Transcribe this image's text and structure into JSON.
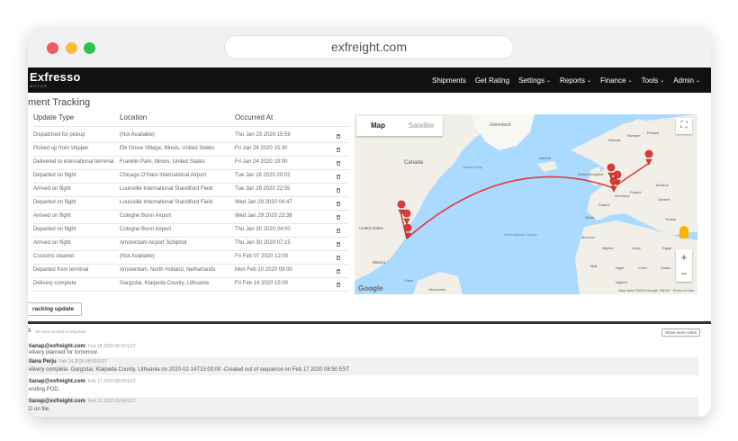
{
  "browser": {
    "url": "exfreight.com"
  },
  "navbar": {
    "brand": "Exfresso",
    "brand_sub": "MOTOR",
    "items": [
      {
        "label": "Shipments",
        "dropdown": false
      },
      {
        "label": "Get Rating",
        "dropdown": false
      },
      {
        "label": "Settings",
        "dropdown": true
      },
      {
        "label": "Reports",
        "dropdown": true
      },
      {
        "label": "Finance",
        "dropdown": true
      },
      {
        "label": "Tools",
        "dropdown": true
      },
      {
        "label": "Admin",
        "dropdown": true
      }
    ]
  },
  "tracking": {
    "title": "ment Tracking",
    "columns": [
      "Update Type",
      "Location",
      "Occurred At"
    ],
    "rows": [
      [
        "Dispatched for pickup",
        "(Not Available)",
        "Thu Jan 23 2020 15:59"
      ],
      [
        "Picked up from shipper",
        "Elk Grove Village, Illinois, United States",
        "Fri Jan 24 2020 15:30"
      ],
      [
        "Delivered to international terminal",
        "Franklin Park, Illinois, United States",
        "Fri Jan 24 2020 19:00"
      ],
      [
        "Departed on flight",
        "Chicago O'Hare International Airport",
        "Tue Jan 28 2020 20:02"
      ],
      [
        "Arrived on flight",
        "Louisville International Standiford Field",
        "Tue Jan 28 2020 22:55"
      ],
      [
        "Departed on flight",
        "Louisville International Standiford Field",
        "Wed Jan 29 2020 04:47"
      ],
      [
        "Arrived on flight",
        "Cologne Bonn Airport",
        "Wed Jan 29 2020 23:38"
      ],
      [
        "Departed on flight",
        "Cologne Bonn Airport",
        "Thu Jan 30 2020 04:00"
      ],
      [
        "Arrived on flight",
        "Amsterdam Airport Schiphol",
        "Thu Jan 30 2020 07:15"
      ],
      [
        "Customs cleared",
        "(Not Available)",
        "Fri Feb 07 2020 12:00"
      ],
      [
        "Departed from terminal",
        "Amsterdam, North Holland, Netherlands",
        "Mon Feb 10 2020 09:00"
      ],
      [
        "Delivery complete",
        "Gargzdai, Klaipeda County, Lithuania",
        "Fri Feb 14 2020 15:00"
      ]
    ],
    "button_label": "racking update"
  },
  "map": {
    "tabs": [
      "Map",
      "Satellite"
    ],
    "active_tab": "Map",
    "labels": {
      "greenland": "Greenland",
      "canada": "Canada",
      "hudson": "Hudson Bay",
      "us": "United States",
      "mexico": "Mexico",
      "atlantic": "North Atlantic Ocean",
      "europe_uk": "United Kingdom",
      "poland": "Poland",
      "belarus": "Belarus",
      "ukraine": "Ukraine",
      "germany": "Germany",
      "france": "France",
      "spain": "Spain",
      "algeria": "Algeria",
      "libya": "Libya",
      "egypt": "Egypt",
      "mali": "Mali",
      "niger": "Niger",
      "chad": "Chad",
      "sudan": "Sudan",
      "sweden": "Sweden",
      "finland": "Finland",
      "norway": "Norway",
      "iceland": "Iceland",
      "turkey": "Turkey",
      "venezuela": "Venezuela",
      "cuba": "Cuba",
      "nigeria": "Nigeria",
      "morocco": "Morocco"
    },
    "zoom_in": "+",
    "zoom_out": "−",
    "fullscreen": "⛶",
    "google": "Google",
    "attribution": "Map data ©2020 Google, INEGI · Terms of Use"
  },
  "notes": {
    "title": "s",
    "count": "33 notes posted to shipment.",
    "show_more": "Show more notes",
    "items": [
      {
        "author": "tianap@exfreight.com",
        "date": "Feb 18 2020 08:10 EST",
        "body": "elivery planned for tomorrow."
      },
      {
        "author": "tiana Perju",
        "date": "Feb 14 2020 08:50 EST",
        "body": "elivery complete. Gargzdai, Klaipeda County, Lithuania on 2020-02-14T15:00:00 -Created out of sequence on Feb 17 2020 08:50 EST"
      },
      {
        "author": "tianap@exfreight.com",
        "date": "Feb 17 2020 08:09 EST",
        "body": "ending POD."
      },
      {
        "author": "tianap@exfreight.com",
        "date": "Feb 12 2020 05:04 EST",
        "body": "D on file."
      }
    ]
  },
  "colors": {
    "navbar": "#111111",
    "route": "#e53935",
    "marker": "#e53935",
    "water": "#aadaff",
    "land": "#f2efe9"
  }
}
